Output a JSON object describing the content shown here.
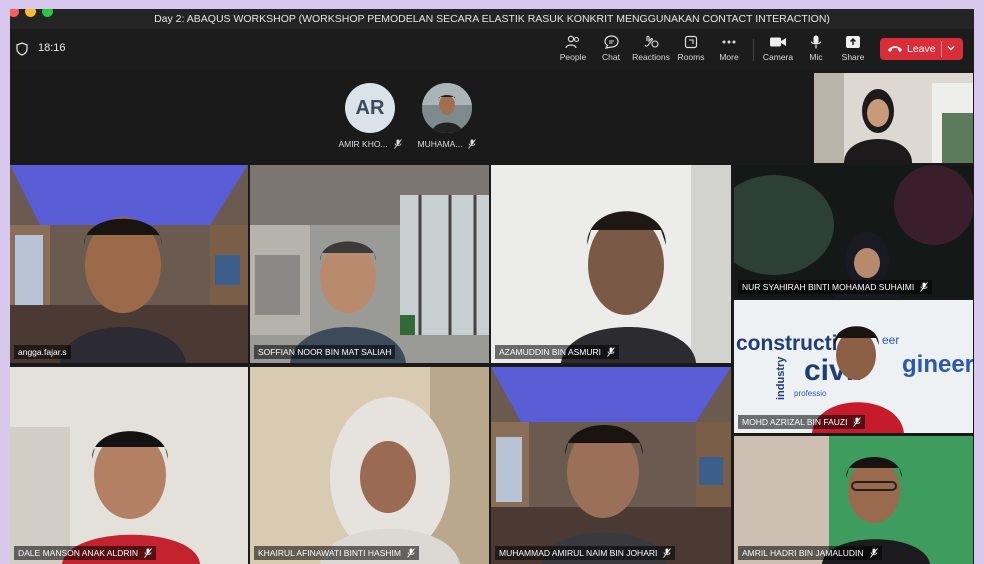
{
  "window": {
    "title": "Day 2: ABAQUS WORKSHOP (WORKSHOP PEMODELAN SECARA ELASTIK RASUK KONKRIT MENGGUNAKAN CONTACT INTERACTION)"
  },
  "toolbar": {
    "timer": "18:16",
    "buttons": [
      {
        "label": "People",
        "icon": "people-icon"
      },
      {
        "label": "Chat",
        "icon": "chat-icon"
      },
      {
        "label": "Reactions",
        "icon": "reactions-icon"
      },
      {
        "label": "Rooms",
        "icon": "rooms-icon"
      },
      {
        "label": "More",
        "icon": "more-icon"
      },
      {
        "label": "Camera",
        "icon": "camera-icon"
      },
      {
        "label": "Mic",
        "icon": "mic-icon"
      },
      {
        "label": "Share",
        "icon": "share-icon"
      }
    ],
    "leave_label": "Leave"
  },
  "avatars": [
    {
      "initials": "AR",
      "name": "AMIR KHO..."
    },
    {
      "initials": "",
      "name": "MUHAMA..."
    }
  ],
  "tiles": [
    {
      "name": "angga.fajar.s",
      "muted": false
    },
    {
      "name": "SOFFIAN NOOR BIN MAT SALIAH",
      "muted": false
    },
    {
      "name": "AZAMUDDIN BIN ASMURI",
      "muted": true
    },
    {
      "name": "NUR SYAHIRAH BINTI MOHAMAD SUHAIMI",
      "muted": true
    },
    {
      "name": "MOHD AZRIZAL BIN FAUZI",
      "muted": true
    },
    {
      "name": "DALE MANSON ANAK ALDRIN",
      "muted": true
    },
    {
      "name": "KHAIRUL AFINAWATI BINTI HASHIM",
      "muted": true
    },
    {
      "name": "MUHAMMAD AMIRUL NAIM BIN JOHARI",
      "muted": true
    },
    {
      "name": "AMRIL HADRI BIN JAMALUDIN",
      "muted": true
    }
  ],
  "background_words": {
    "construction": "constructi",
    "civil": "civil",
    "engineering": "gineering",
    "industry": "industry",
    "professio": "professio",
    "eer": "eer"
  },
  "colors": {
    "leave": "#d92d39",
    "bg": "#1a1a1a",
    "frame": "#d9c8ee"
  }
}
